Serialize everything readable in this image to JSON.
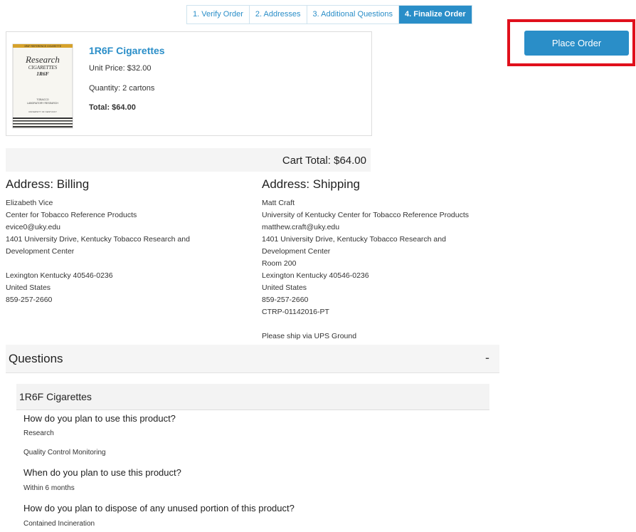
{
  "steps": [
    {
      "label": "1. Verify Order"
    },
    {
      "label": "2. Addresses"
    },
    {
      "label": "3. Additional Questions"
    },
    {
      "label": "4. Finalize Order"
    }
  ],
  "product": {
    "name": "1R6F Cigarettes",
    "unit_price": "Unit Price: $32.00",
    "quantity": "Quantity: 2 cartons",
    "total": "Total: $64.00",
    "image": {
      "top_banner": "1R6F REFERENCE CIGARETTE",
      "brand": "Research",
      "subtitle": "CIGARETTES",
      "code": "1R6F",
      "lab1": "TOBACCO",
      "lab2": "LABORATORY RESEARCH",
      "university": "UNIVERSITY OF KENTUCKY"
    }
  },
  "place_order_label": "Place Order",
  "cart_total": "Cart Total: $64.00",
  "billing": {
    "title": "Address: Billing",
    "lines": [
      "Elizabeth Vice",
      "Center for Tobacco Reference Products",
      "evice0@uky.edu",
      "1401 University Drive, Kentucky Tobacco Research and",
      "Development Center",
      "",
      "Lexington Kentucky 40546-0236",
      "United States",
      "859-257-2660"
    ]
  },
  "shipping": {
    "title": "Address: Shipping",
    "lines": [
      "Matt Craft",
      "University of Kentucky Center for Tobacco Reference Products",
      "matthew.craft@uky.edu",
      "1401 University Drive, Kentucky Tobacco Research and",
      "Development Center",
      "Room 200",
      "Lexington Kentucky 40546-0236",
      "United States",
      "859-257-2660",
      "CTRP-01142016-PT",
      "",
      "Please ship via UPS Ground"
    ]
  },
  "questions": {
    "title": "Questions",
    "toggle": "-",
    "product_title": "1R6F Cigarettes",
    "items": [
      {
        "q": "How do you plan to use this product?",
        "answers": [
          "Research",
          "Quality Control Monitoring"
        ]
      },
      {
        "q": "When do you plan to use this product?",
        "answers": [
          "Within 6 months"
        ]
      },
      {
        "q": "How do you plan to dispose of any unused portion of this product?",
        "answers": [
          "Contained Incineration"
        ]
      }
    ]
  },
  "colors": {
    "accent": "#2a8ec8",
    "highlight": "#e0101c"
  }
}
